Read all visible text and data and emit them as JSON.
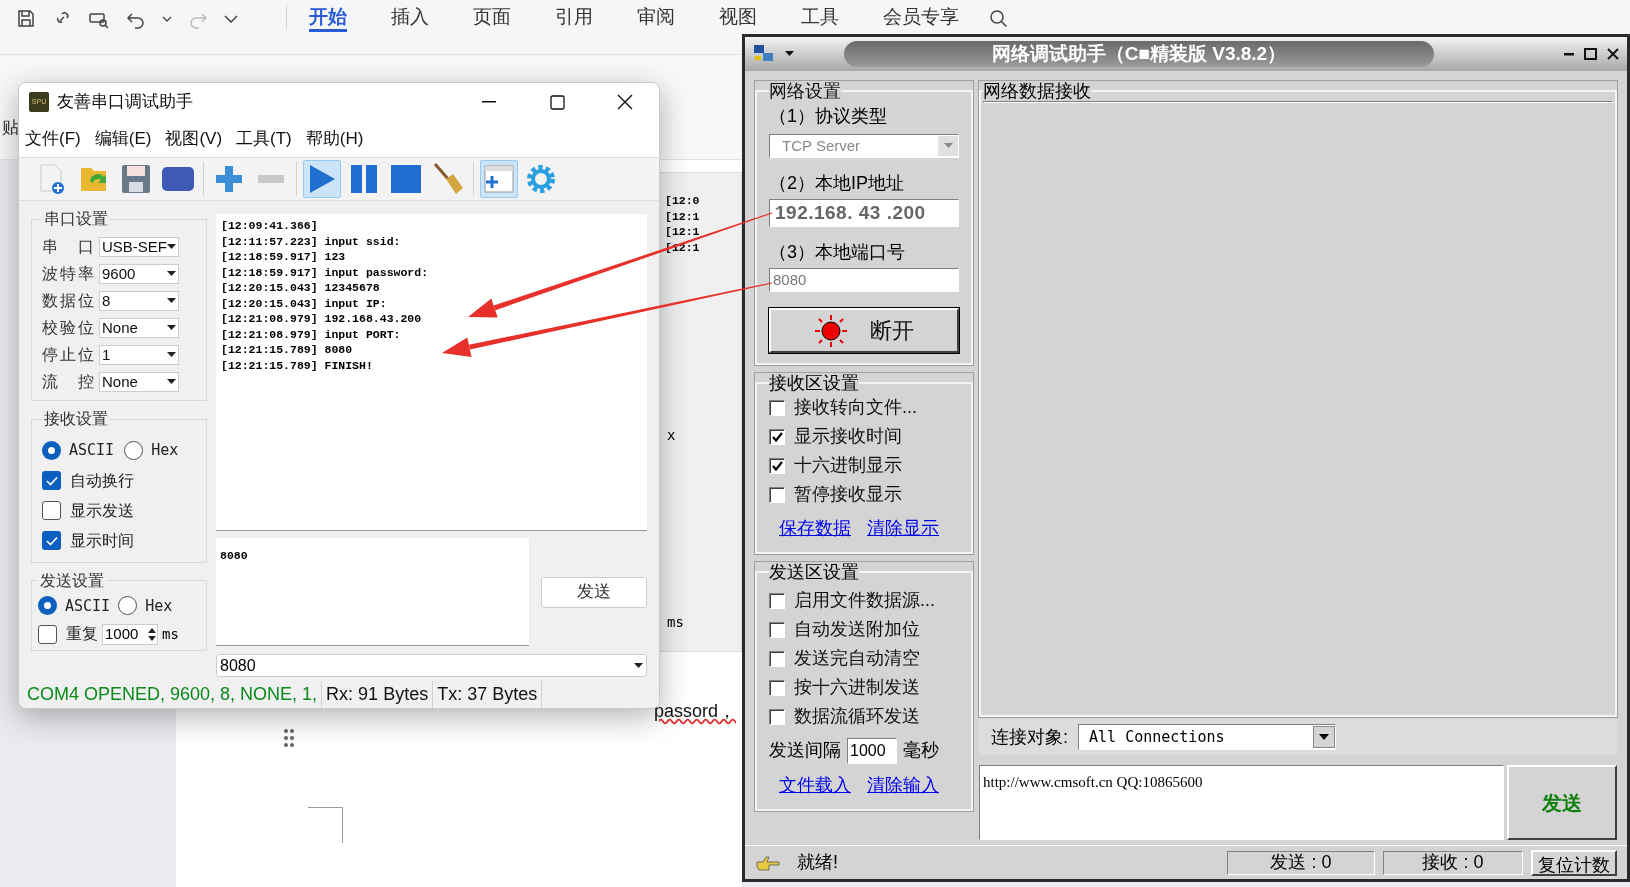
{
  "editor": {
    "tabs": [
      {
        "label": "开始",
        "selected": true
      },
      {
        "label": "插入",
        "selected": false
      },
      {
        "label": "页面",
        "selected": false
      },
      {
        "label": "引用",
        "selected": false
      },
      {
        "label": "审阅",
        "selected": false
      },
      {
        "label": "视图",
        "selected": false
      },
      {
        "label": "工具",
        "selected": false
      },
      {
        "label": "会员专享",
        "selected": false
      }
    ],
    "side_fragment": "贴",
    "log_fragments": [
      "[12:0",
      "[12:1",
      "[12:1",
      "[12:1"
    ],
    "x_fragment": "x",
    "ms_fragment": "ms",
    "doc_text": "passord，"
  },
  "serial_window": {
    "icon_text": "SPU",
    "title": "友善串口调试助手",
    "menus": [
      "文件(F)",
      "编辑(E)",
      "视图(V)",
      "工具(T)",
      "帮助(H)"
    ],
    "toolbar": [
      {
        "pressed": false
      },
      {
        "pressed": false
      },
      {
        "pressed": false
      },
      {
        "pressed": false
      },
      {
        "pressed": false
      },
      {
        "pressed": false
      },
      {
        "pressed": true
      },
      {
        "pressed": false
      },
      {
        "pressed": false
      },
      {
        "pressed": false
      },
      {
        "pressed": true
      },
      {
        "pressed": false
      }
    ],
    "port_settings": {
      "title": "串口设置",
      "fields": [
        {
          "label": "串 口",
          "value": "USB-SEF"
        },
        {
          "label": "波特率",
          "value": "9600"
        },
        {
          "label": "数据位",
          "value": "8"
        },
        {
          "label": "校验位",
          "value": "None"
        },
        {
          "label": "停止位",
          "value": "1"
        },
        {
          "label": "流 控",
          "value": "None"
        }
      ]
    },
    "receive_settings": {
      "title": "接收设置",
      "modes": [
        {
          "label": "ASCII",
          "selected": true
        },
        {
          "label": "Hex",
          "selected": false
        }
      ],
      "options": [
        {
          "label": "自动换行",
          "checked": true
        },
        {
          "label": "显示发送",
          "checked": false
        },
        {
          "label": "显示时间",
          "checked": true
        }
      ]
    },
    "send_settings": {
      "title": "发送设置",
      "modes": [
        {
          "label": "ASCII",
          "selected": true
        },
        {
          "label": "Hex",
          "selected": false
        }
      ],
      "repeat": {
        "label": "重复",
        "checked": false,
        "interval": "1000",
        "unit": "ms"
      }
    },
    "log_lines": [
      "[12:09:41.366]",
      "[12:11:57.223] input ssid:",
      "[12:18:59.917] 123",
      "[12:18:59.917] input password:",
      "[12:20:15.043] 12345678",
      "[12:20:15.043] input IP:",
      "[12:21:08.979] 192.168.43.200",
      "[12:21:08.979] input PORT:",
      "[12:21:15.789] 8080",
      "[12:21:15.789] FINISH!"
    ],
    "send_text": "8080",
    "send_button": "发送",
    "history": "8080",
    "status": [
      "COM4 OPENED, 9600, 8, NONE, 1,",
      "Rx: 91 Bytes",
      "Tx: 37 Bytes"
    ]
  },
  "net_window": {
    "title": "网络调试助手（C■精装版 V3.8.2）",
    "network": {
      "title": "网络设置",
      "protocol_label": "（1）协议类型",
      "protocol": "TCP Server",
      "ip_label": "（2）本地IP地址",
      "ip": "192.168. 43 .200",
      "port_label": "（3）本地端口号",
      "port": "8080",
      "connect_button": "断开"
    },
    "receive_title": "网络数据接收",
    "receive_settings": {
      "title": "接收区设置",
      "options": [
        {
          "label": "接收转向文件...",
          "checked": false
        },
        {
          "label": "显示接收时间",
          "checked": true
        },
        {
          "label": "十六进制显示",
          "checked": true
        },
        {
          "label": "暂停接收显示",
          "checked": false
        }
      ],
      "links": [
        "保存数据",
        "清除显示"
      ]
    },
    "send_settings": {
      "title": "发送区设置",
      "options": [
        {
          "label": "启用文件数据源...",
          "checked": false
        },
        {
          "label": "自动发送附加位",
          "checked": false
        },
        {
          "label": "发送完自动清空",
          "checked": false
        },
        {
          "label": "按十六进制发送",
          "checked": false
        },
        {
          "label": "数据流循环发送",
          "checked": false
        }
      ],
      "interval_label": "发送间隔",
      "interval": "1000",
      "unit": "毫秒",
      "links": [
        "文件载入",
        "清除输入"
      ]
    },
    "target_label": "连接对象:",
    "target": "All Connections",
    "send_text": "http://www.cmsoft.cn QQ:10865600",
    "send_button": "发送",
    "status": {
      "ready": "就绪!",
      "sent": "发送 : 0",
      "received": "接收 : 0",
      "reset_button": "复位计数"
    }
  }
}
